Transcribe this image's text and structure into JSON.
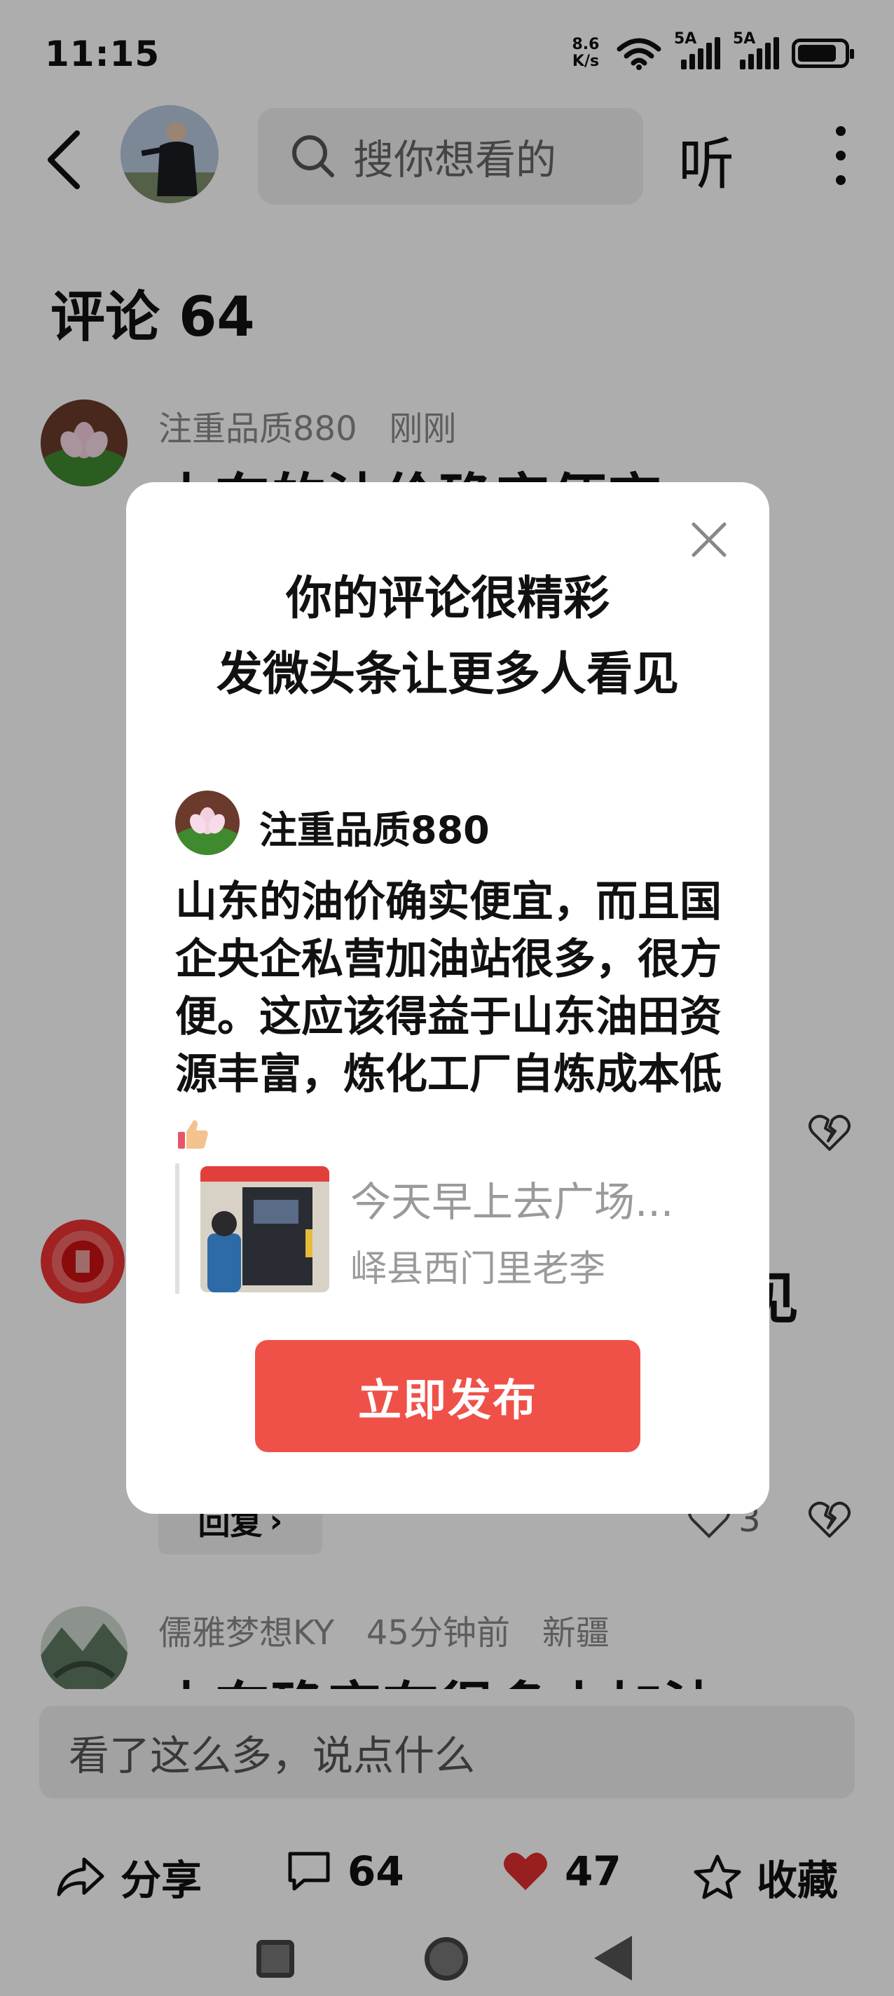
{
  "status_bar": {
    "time": "11:15",
    "net_speed_value": "8.6",
    "net_speed_unit": "K/s",
    "sim1_label": "5A",
    "sim2_label": "5A",
    "battery_level": 0.85,
    "icons": [
      "wifi-icon",
      "signal-icon",
      "battery-icon"
    ]
  },
  "top_bar": {
    "search_placeholder": "搜你想看的",
    "listen_label": "听",
    "icons": [
      "back-icon",
      "search-icon",
      "more-icon"
    ]
  },
  "comments": {
    "title": "评论 64",
    "items": [
      {
        "author": "注重品质880",
        "time": "刚刚",
        "text_fragment": "山东的油价确实便宜"
      },
      {
        "text_fragment": "见",
        "reply_label": "回复",
        "like_count": "3"
      },
      {
        "author": "儒雅梦想KY",
        "time": "45分钟前",
        "location": "新疆",
        "text_fragment": "山东确实有很多小加油"
      }
    ]
  },
  "input": {
    "placeholder": "看了这么多，说点什么"
  },
  "actions": {
    "share_label": "分享",
    "comment_count": "64",
    "like_count": "47",
    "favorite_label": "收藏"
  },
  "modal": {
    "title_line1": "你的评论很精彩",
    "title_line2": "发微头条让更多人看见",
    "username": "注重品质880",
    "comment_text": "山东的油价确实便宜，而且国企央企私营加油站很多，很方便。这应该得益于山东油田资源丰富，炼化工厂自炼成本低",
    "quote_title": "今天早上去广场...",
    "quote_author": "峄县西门里老李",
    "publish_label": "立即发布"
  },
  "colors": {
    "accent": "#ef5148",
    "like_red": "#e02e2e",
    "muted_text": "#8a8a8a"
  }
}
